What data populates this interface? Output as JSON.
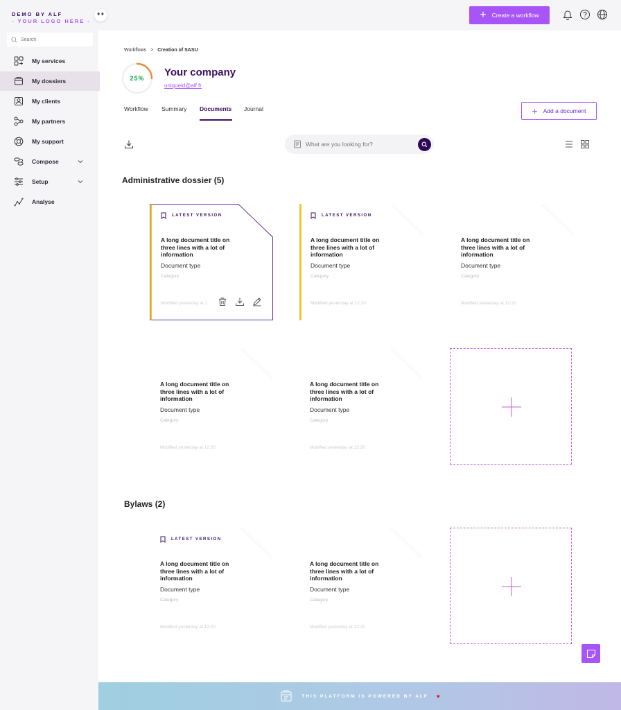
{
  "brand": {
    "line1": "DEMO BY ALF",
    "line2": "- YOUR LOGO HERE -"
  },
  "topbar": {
    "create_label": "Create a workflow"
  },
  "sidebar": {
    "search_placeholder": "Search",
    "items": [
      {
        "label": "My services",
        "icon": "services-icon"
      },
      {
        "label": "My dossiers",
        "icon": "folder-icon"
      },
      {
        "label": "My clients",
        "icon": "clients-icon"
      },
      {
        "label": "My partners",
        "icon": "partners-icon"
      },
      {
        "label": "My support",
        "icon": "support-icon"
      },
      {
        "label": "Compose",
        "icon": "compose-icon"
      },
      {
        "label": "Setup",
        "icon": "setup-icon"
      },
      {
        "label": "Analyse",
        "icon": "analyse-icon"
      }
    ]
  },
  "breadcrumb": {
    "parent": "Workflows",
    "separator": ">",
    "current": "Creation of SASU"
  },
  "company": {
    "progress_label": "25%",
    "progress_value": 0.25,
    "name": "Your company",
    "email": "uniqueid@alf.fr"
  },
  "tabs": [
    "Workflow",
    "Summary",
    "Documents",
    "Journal"
  ],
  "add_document_label": "Add a document",
  "main_search": {
    "placeholder": "What are you looking for?"
  },
  "sections": [
    {
      "title": "Administrative dossier (5)"
    },
    {
      "title": "Bylaws (2)"
    }
  ],
  "card": {
    "badge": "LATEST VERSION",
    "title": "A long document title on three lines with a lot of information",
    "type": "Document type",
    "category": "Category",
    "modified": "Modified yesterday at 12:20",
    "modified_short": "Modified yesterday at 1"
  },
  "footer": {
    "text": "THIS PLATFORM IS POWERED BY ALF",
    "heart": "♥"
  },
  "colors": {
    "accent": "#a855f7",
    "brand_dark": "#3a1060",
    "latest_bar": "#f2c230",
    "progress_green": "#16a34a"
  }
}
